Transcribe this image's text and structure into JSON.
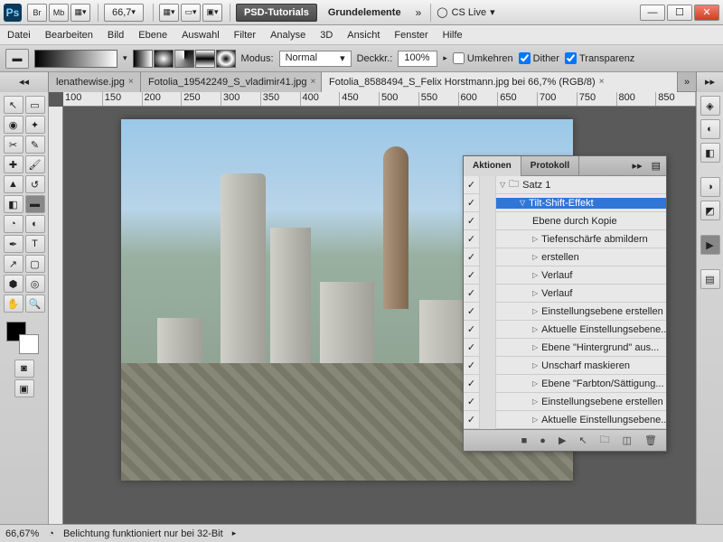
{
  "titlebar": {
    "br": "Br",
    "mb": "Mb",
    "zoom": "66,7",
    "psd_tut": "PSD-Tutorials",
    "workspace": "Grundelemente",
    "cslive": "CS Live"
  },
  "menu": [
    "Datei",
    "Bearbeiten",
    "Bild",
    "Ebene",
    "Auswahl",
    "Filter",
    "Analyse",
    "3D",
    "Ansicht",
    "Fenster",
    "Hilfe"
  ],
  "optbar": {
    "modus_lbl": "Modus:",
    "modus_val": "Normal",
    "deck_lbl": "Deckkr.:",
    "deck_val": "100%",
    "umkehren": "Umkehren",
    "dither": "Dither",
    "transparenz": "Transparenz"
  },
  "tabs": [
    {
      "label": "lenathewise.jpg"
    },
    {
      "label": "Fotolia_19542249_S_vladimir41.jpg"
    },
    {
      "label": "Fotolia_8588494_S_Felix Horstmann.jpg bei 66,7% (RGB/8)"
    }
  ],
  "ruler": [
    "100",
    "150",
    "200",
    "250",
    "300",
    "350",
    "400",
    "450",
    "500",
    "550",
    "600",
    "650",
    "700",
    "750",
    "800",
    "850"
  ],
  "actions": {
    "tab1": "Aktionen",
    "tab2": "Protokoll",
    "set": "Satz 1",
    "rows": [
      {
        "t": "Tilt-Shift-Effekt",
        "sel": true,
        "open": true,
        "ind": 1
      },
      {
        "t": "Ebene durch Kopie",
        "ind": 2,
        "leaf": true
      },
      {
        "t": "Tiefenschärfe abmildern",
        "ind": 2
      },
      {
        "t": "erstellen",
        "ind": 2
      },
      {
        "t": "Verlauf",
        "ind": 2
      },
      {
        "t": "Verlauf",
        "ind": 2
      },
      {
        "t": "Einstellungsebene erstellen",
        "ind": 2
      },
      {
        "t": "Aktuelle Einstellungsebene...",
        "ind": 2
      },
      {
        "t": "Ebene \"Hintergrund\" aus...",
        "ind": 2
      },
      {
        "t": "Unscharf maskieren",
        "ind": 2
      },
      {
        "t": "Ebene \"Farbton/Sättigung...",
        "ind": 2
      },
      {
        "t": "Einstellungsebene erstellen",
        "ind": 2
      },
      {
        "t": "Aktuelle Einstellungsebene...",
        "ind": 2
      }
    ]
  },
  "status": {
    "zoom": "66,67%",
    "msg": "Belichtung funktioniert nur bei 32-Bit"
  }
}
